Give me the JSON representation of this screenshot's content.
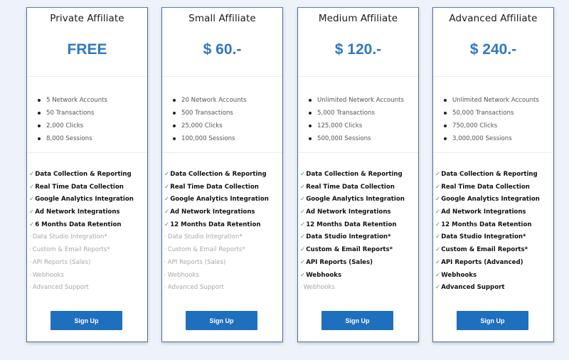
{
  "plans": [
    {
      "title": "Private Affiliate",
      "price": "FREE",
      "usage": [
        "5 Network Accounts",
        "50 Transactions",
        "2,000 Clicks",
        "8,000 Sessions"
      ],
      "features": [
        {
          "label": "Data Collection & Reporting",
          "included": true
        },
        {
          "label": "Real Time Data Collection",
          "included": true
        },
        {
          "label": "Google Analytics Integration",
          "included": true
        },
        {
          "label": "Ad Network Integrations",
          "included": true
        },
        {
          "label": "6 Months Data Retention",
          "included": true
        },
        {
          "label": "Data Studio Integration*",
          "included": false
        },
        {
          "label": "Custom & Email Reports*",
          "included": false
        },
        {
          "label": "API Reports (Sales)",
          "included": false
        },
        {
          "label": "Webhooks",
          "included": false
        },
        {
          "label": "Advanced Support",
          "included": false
        }
      ],
      "cta": "Sign Up"
    },
    {
      "title": "Small Affiliate",
      "price": "$ 60.-",
      "usage": [
        "20 Network Accounts",
        "500 Transactions",
        "25,000 Clicks",
        "100,000 Sessions"
      ],
      "features": [
        {
          "label": "Data Collection & Reporting",
          "included": true
        },
        {
          "label": "Real Time Data Collection",
          "included": true
        },
        {
          "label": "Google Analytics Integration",
          "included": true
        },
        {
          "label": "Ad Network Integrations",
          "included": true
        },
        {
          "label": "12 Months Data Retention",
          "included": true
        },
        {
          "label": "Data Studio Integration*",
          "included": false
        },
        {
          "label": "Custom & Email Reports*",
          "included": false
        },
        {
          "label": "API Reports (Sales)",
          "included": false
        },
        {
          "label": "Webhooks",
          "included": false
        },
        {
          "label": "Advanced Support",
          "included": false
        }
      ],
      "cta": "Sign Up"
    },
    {
      "title": "Medium Affiliate",
      "price": "$ 120.-",
      "usage": [
        "Unlimited Network Accounts",
        "5,000 Transactions",
        "125,000 Clicks",
        "500,000 Sessions"
      ],
      "features": [
        {
          "label": "Data Collection & Reporting",
          "included": true
        },
        {
          "label": "Real Time Data Collection",
          "included": true
        },
        {
          "label": "Google Analytics Integration",
          "included": true
        },
        {
          "label": "Ad Network Integrations",
          "included": true
        },
        {
          "label": "12 Months Data Retention",
          "included": true
        },
        {
          "label": "Data Studio Integration*",
          "included": true
        },
        {
          "label": "Custom & Email Reports*",
          "included": true
        },
        {
          "label": "API Reports (Sales)",
          "included": true
        },
        {
          "label": "Webhooks",
          "included": true
        },
        {
          "label": "Webhooks",
          "included": false
        }
      ],
      "cta": "Sign Up"
    },
    {
      "title": "Advanced Affiliate",
      "price": "$ 240.-",
      "usage": [
        "Unlimited Network Accounts",
        "50,000 Transactions",
        "750,000 Clicks",
        "3,000,000 Sessions"
      ],
      "features": [
        {
          "label": "Data Collection & Reporting",
          "included": true
        },
        {
          "label": "Real Time Data Collection",
          "included": true
        },
        {
          "label": "Google Analytics Integration",
          "included": true
        },
        {
          "label": "Ad Network Integrations",
          "included": true
        },
        {
          "label": "12 Months Data Retention",
          "included": true
        },
        {
          "label": "Data Studio Integration*",
          "included": true
        },
        {
          "label": "Custom & Email Reports*",
          "included": true
        },
        {
          "label": "API Reports (Advanced)",
          "included": true
        },
        {
          "label": "Webhooks",
          "included": true
        },
        {
          "label": "Advanced Support",
          "included": true
        }
      ],
      "cta": "Sign Up"
    }
  ],
  "icons": {
    "included": "check-icon",
    "excluded": "dash-icon"
  },
  "colors": {
    "background": "#eef3f9",
    "price": "#2f78c2",
    "button": "#1f6fbf",
    "check": "#3aa04a",
    "excluded_text": "#a8a8a8",
    "card_border": "#4d6f95"
  }
}
